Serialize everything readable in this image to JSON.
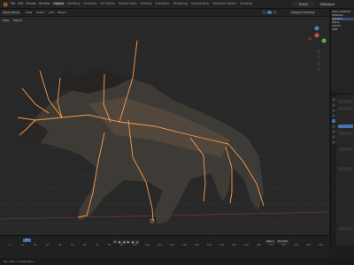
{
  "topbar": {
    "menus": [
      "File",
      "Edit",
      "Render",
      "Window",
      "Help"
    ],
    "tabs": [
      "Layout",
      "Modeling",
      "Sculpting",
      "UV Editing",
      "Texture Paint",
      "Shading",
      "Animation",
      "Rendering",
      "Compositing",
      "Geometry Nodes",
      "Scripting"
    ],
    "active_tab": "Layout",
    "scene": "Scene",
    "view_layer": "ViewLayer"
  },
  "viewport": {
    "header_buttons": [
      "Object Mode",
      "View",
      "Select",
      "Add",
      "Object"
    ],
    "tool_buttons": [
      "Pose",
      "Object"
    ],
    "shading_label": "Viewport Shading",
    "colors": {
      "background": "#282828",
      "grid": "#343434",
      "bone": "#ff9a4a"
    }
  },
  "outliner": {
    "rows": [
      "Scene Collection",
      "Collection",
      "Armature",
      "Hyena",
      "Camera",
      "Light"
    ],
    "selected_row": "Armature"
  },
  "timeline": {
    "current_frame": "1",
    "ticks": [
      "0",
      "10",
      "20",
      "30",
      "40",
      "50",
      "60",
      "70",
      "80",
      "90",
      "100",
      "110",
      "120",
      "130",
      "140",
      "150",
      "160",
      "170",
      "180",
      "190",
      "200",
      "210",
      "220",
      "230",
      "240",
      "250"
    ],
    "start": "Start 1",
    "end": "End 250"
  },
  "statusbar": {
    "text": "Pan View  ·  Context Menu"
  },
  "theme": {
    "accent": "#4772b3"
  }
}
